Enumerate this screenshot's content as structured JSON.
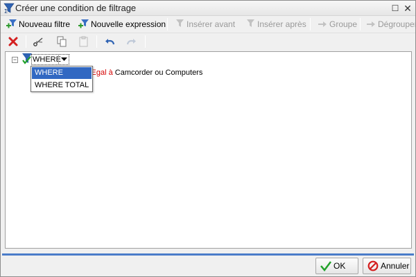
{
  "window": {
    "title": "Créer une condition de filtrage",
    "icons": {
      "title": "filter-sigma-icon",
      "maximize": "maximize-icon",
      "close": "close-icon"
    }
  },
  "toolbar1": {
    "new_filter": "Nouveau filtre",
    "new_expression": "Nouvelle expression",
    "insert_before": "Insérer avant",
    "insert_after": "Insérer après",
    "group": "Groupe",
    "ungroup": "Dégrouper"
  },
  "toolbar2": {
    "icons": [
      "delete-icon",
      "cut-icon",
      "copy-icon",
      "paste-icon",
      "undo-icon",
      "redo-icon"
    ]
  },
  "tree": {
    "where_value": "WHERE",
    "condition_field": "gorie",
    "condition_operator": "Egal à",
    "condition_values": "Camcorder ou Computers"
  },
  "dropdown": {
    "options": [
      "WHERE",
      "WHERE TOTAL"
    ],
    "selected": "WHERE"
  },
  "buttons": {
    "ok": "OK",
    "cancel": "Annuler"
  },
  "colors": {
    "accent": "#4a7cc9",
    "selection": "#3168c2",
    "operator": "#d40000"
  }
}
